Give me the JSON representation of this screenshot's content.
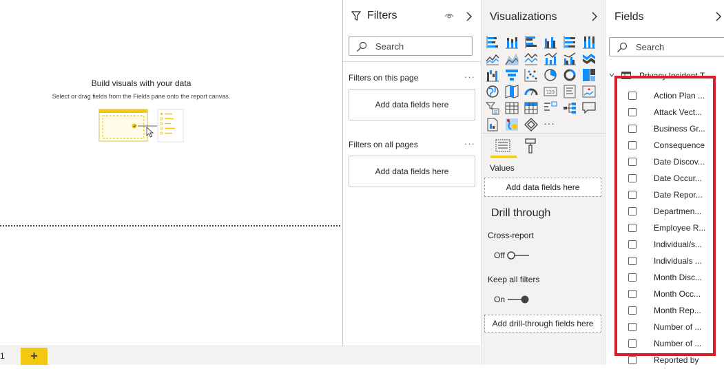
{
  "canvas": {
    "build_title": "Build visuals with your data",
    "build_subtitle": "Select or drag fields from the Fields pane onto the report canvas.",
    "page_number": "1",
    "add_page": "+"
  },
  "filters": {
    "title": "Filters",
    "search_placeholder": "Search",
    "on_this_page": "Filters on this page",
    "on_all_pages": "Filters on all pages",
    "add_fields": "Add data fields here",
    "more": "···"
  },
  "visualizations": {
    "title": "Visualizations",
    "more": "···",
    "values_label": "Values",
    "add_fields": "Add data fields here",
    "drill_through": "Drill through",
    "cross_report": "Cross-report",
    "cross_report_state": "Off",
    "keep_all_filters": "Keep all filters",
    "keep_all_filters_state": "On",
    "add_drill_through": "Add drill-through fields here"
  },
  "fields": {
    "title": "Fields",
    "search_placeholder": "Search",
    "table_name": "Privacy Incident T...",
    "items": [
      "Action Plan ...",
      "Attack Vect...",
      "Business Gr...",
      "Consequence",
      "Date Discov...",
      "Date Occur...",
      "Date Repor...",
      "Departmen...",
      "Employee R...",
      "Individual/s...",
      "Individuals ...",
      "Month Disc...",
      "Month Occ...",
      "Month Rep...",
      "Number of ...",
      "Number of ...",
      "Reported by"
    ]
  },
  "colors": {
    "accent_yellow": "#f2c811",
    "highlight_red": "#d7202b",
    "pane_gray": "#f3f2f1"
  }
}
